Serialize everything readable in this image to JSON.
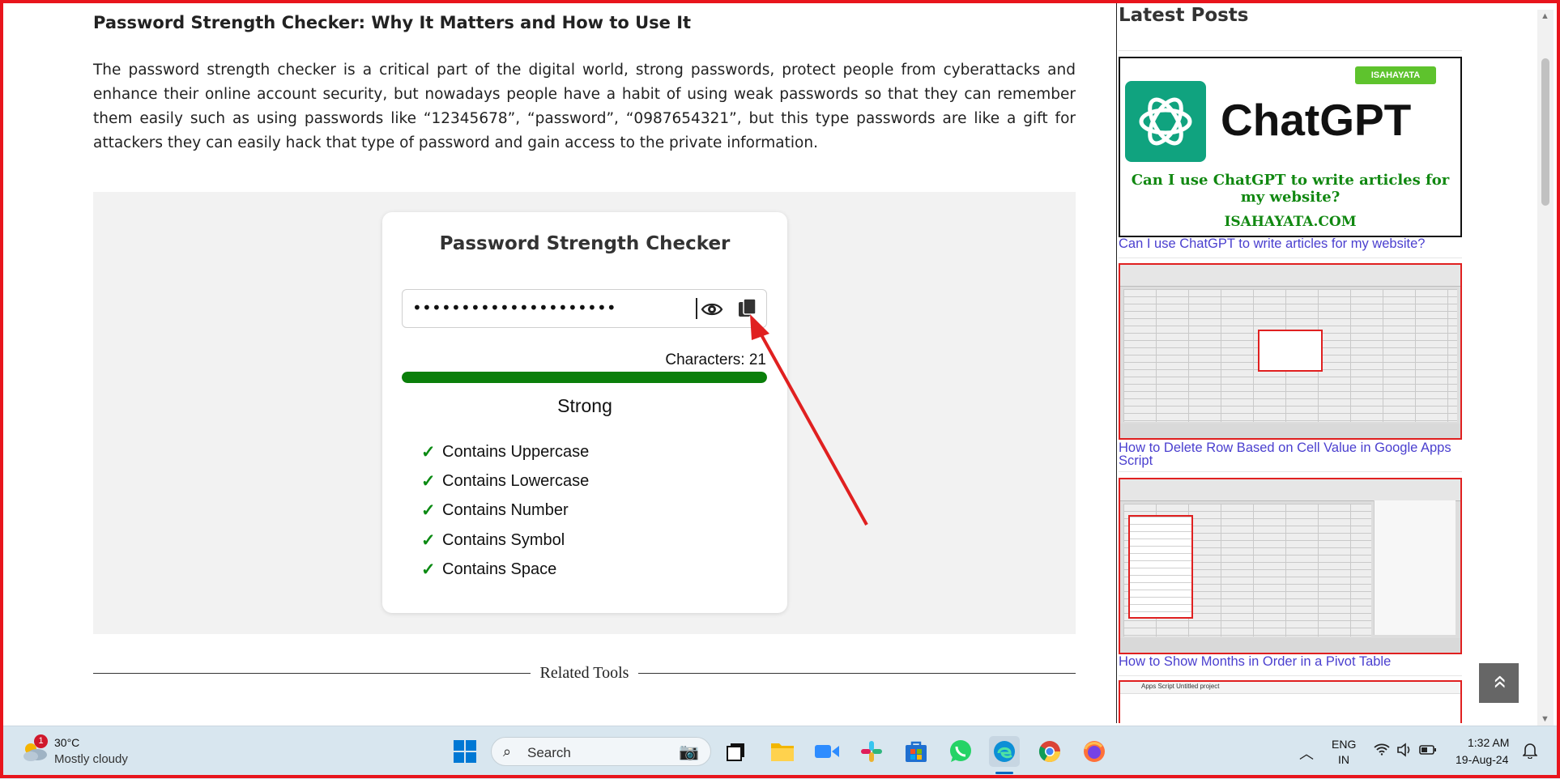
{
  "article": {
    "title": "Password Strength Checker: Why It Matters and How to Use It",
    "paragraph": "The password strength checker is a critical part of the digital world, strong passwords, protect people from cyberattacks and enhance their online account security, but nowadays people have a habit of using weak passwords so that they can remember them easily such as using passwords like “12345678”, “password”, “0987654321”, but this type passwords are like a gift for attackers they can easily hack that type of password and gain access to the private information."
  },
  "tool": {
    "title": "Password Strength Checker",
    "password_masked": "•••••••••••••••••••••",
    "char_count": "Characters: 21",
    "strength_label": "Strong",
    "strength_fill": 1.0,
    "strength_color": "#0a7f0a",
    "checks": [
      {
        "label": "Contains Uppercase"
      },
      {
        "label": "Contains Lowercase"
      },
      {
        "label": "Contains Number"
      },
      {
        "label": "Contains Symbol"
      },
      {
        "label": "Contains Space"
      }
    ],
    "check_mark": "✓"
  },
  "related": {
    "label": "Related Tools"
  },
  "sidebar": {
    "heading": "Latest Posts",
    "posts": [
      {
        "title": "Can I use ChatGPT to write articles for my website?",
        "thumb": {
          "brand": "ChatGPT",
          "tag": "ISAHAYATA",
          "subtitle": "Can I use ChatGPT to write articles for my website?",
          "footer": "ISAHAYATA.COM"
        }
      },
      {
        "title": "How to Delete Row Based on Cell Value in Google Apps Script"
      },
      {
        "title": "How to Show Months in Order in a Pivot Table"
      },
      {
        "title": "Apps Script  Untitled project"
      }
    ]
  },
  "back_to_top": "»",
  "taskbar": {
    "weather": {
      "temp": "30°C",
      "desc": "Mostly cloudy",
      "badge": "1"
    },
    "search_label": "Search",
    "apps": [
      "windows-start",
      "task-view",
      "file-explorer",
      "zoom",
      "slack",
      "microsoft-store",
      "whatsapp",
      "edge",
      "chrome",
      "firefox"
    ],
    "language": {
      "line1": "ENG",
      "line2": "IN"
    },
    "clock": {
      "time": "1:32 AM",
      "date": "19-Aug-24"
    }
  },
  "colors": {
    "frame": "#e8141c",
    "accent_green": "#0a7f0a",
    "link": "#4a3fcf",
    "arrow": "#e02020"
  }
}
